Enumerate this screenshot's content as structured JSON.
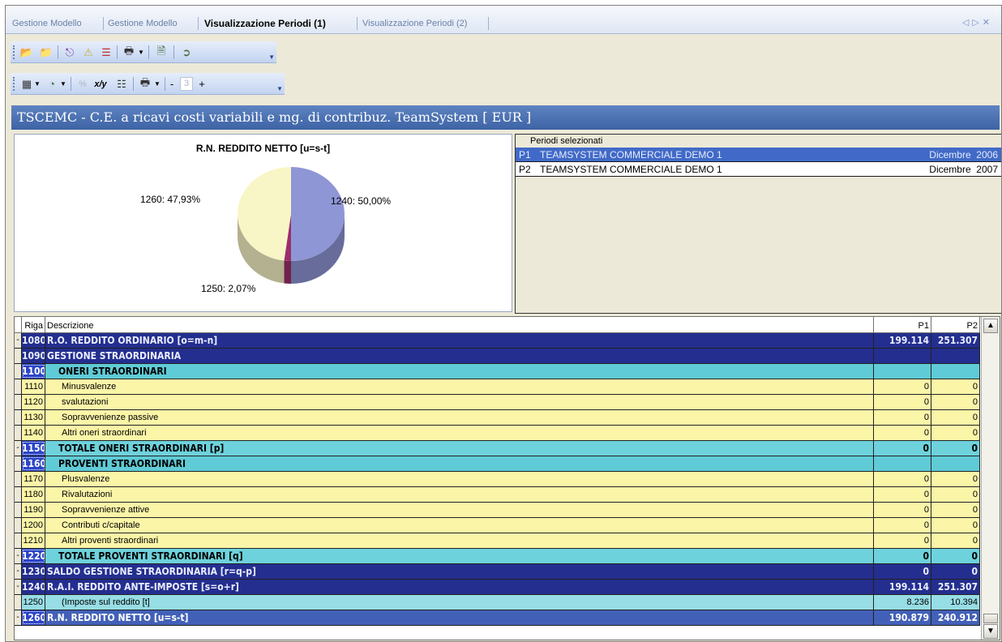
{
  "tabs": [
    {
      "label": "Gestione Modello",
      "active": false
    },
    {
      "label": "Gestione Modello",
      "active": false
    },
    {
      "label": "Visualizzazione Periodi (1)",
      "active": true
    },
    {
      "label": "Visualizzazione Periodi (2)",
      "active": false
    }
  ],
  "tab_nav": {
    "prev": "◁",
    "next": "▷",
    "close": "✕"
  },
  "toolbar2": {
    "field_value": "3",
    "minus": "-",
    "plus": "+",
    "ratio_label": "x/y",
    "percent_label": "%"
  },
  "report_title": "TSCEMC - C.E. a ricavi costi variabili e mg. di contribuz. TeamSystem [ EUR ]",
  "chart": {
    "title": "R.N. REDDITO NETTO [u=s-t]",
    "labels": {
      "a": "1240: 50,00%",
      "b": "1260: 47,93%",
      "c": "1250: 2,07%"
    }
  },
  "chart_data": {
    "type": "pie",
    "title": "R.N. REDDITO NETTO [u=s-t]",
    "slices": [
      {
        "label": "1240",
        "value": 50.0,
        "color": "#8f96d6"
      },
      {
        "label": "1250",
        "value": 2.07,
        "color": "#9b2f6a"
      },
      {
        "label": "1260",
        "value": 47.93,
        "color": "#f8f6c6"
      }
    ]
  },
  "periods": {
    "header": "Periodi selezionati",
    "rows": [
      {
        "code": "P1",
        "name": "TEAMSYSTEM COMMERCIALE DEMO 1",
        "date": "Dicembre  2006",
        "selected": true
      },
      {
        "code": "P2",
        "name": "TEAMSYSTEM COMMERCIALE DEMO 1",
        "date": "Dicembre  2007",
        "selected": false
      }
    ]
  },
  "grid": {
    "headers": {
      "riga": "Riga",
      "descrizione": "Descrizione",
      "p1": "P1",
      "p2": "P2"
    },
    "rows": [
      {
        "mark": "-",
        "riga": "1080",
        "desc": "R.O. REDDITO ORDINARIO [o=m-n]",
        "p1": "199.114",
        "p2": "251.307"
      },
      {
        "mark": "",
        "riga": "1090",
        "desc": "GESTIONE STRAORDINARIA",
        "p1": "",
        "p2": ""
      },
      {
        "mark": "",
        "riga": "1100",
        "desc": "ONERI STRAORDINARI",
        "p1": "",
        "p2": ""
      },
      {
        "mark": "",
        "riga": "1110",
        "desc": "Minusvalenze",
        "p1": "0",
        "p2": "0"
      },
      {
        "mark": "",
        "riga": "1120",
        "desc": "svalutazioni",
        "p1": "0",
        "p2": "0"
      },
      {
        "mark": "",
        "riga": "1130",
        "desc": "Sopravvenienze passive",
        "p1": "0",
        "p2": "0"
      },
      {
        "mark": "",
        "riga": "1140",
        "desc": "Altri oneri straordinari",
        "p1": "0",
        "p2": "0"
      },
      {
        "mark": "-",
        "riga": "1150",
        "desc": "TOTALE ONERI STRAORDINARI [p]",
        "p1": "0",
        "p2": "0"
      },
      {
        "mark": "",
        "riga": "1160",
        "desc": "PROVENTI STRAORDINARI",
        "p1": "",
        "p2": ""
      },
      {
        "mark": "",
        "riga": "1170",
        "desc": "Plusvalenze",
        "p1": "0",
        "p2": "0"
      },
      {
        "mark": "",
        "riga": "1180",
        "desc": "Rivalutazioni",
        "p1": "0",
        "p2": "0"
      },
      {
        "mark": "",
        "riga": "1190",
        "desc": "Sopravvenienze attive",
        "p1": "0",
        "p2": "0"
      },
      {
        "mark": "",
        "riga": "1200",
        "desc": "Contributi c/capitale",
        "p1": "0",
        "p2": "0"
      },
      {
        "mark": "",
        "riga": "1210",
        "desc": "Altri proventi straordinari",
        "p1": "0",
        "p2": "0"
      },
      {
        "mark": "-",
        "riga": "1220",
        "desc": "TOTALE PROVENTI STRAORDINARI [q]",
        "p1": "0",
        "p2": "0"
      },
      {
        "mark": "-",
        "riga": "1230",
        "desc": "SALDO GESTIONE STRAORDINARIA [r=q-p]",
        "p1": "0",
        "p2": "0"
      },
      {
        "mark": "-",
        "riga": "1240",
        "desc": "R.A.I. REDDITO ANTE-IMPOSTE [s=o+r]",
        "p1": "199.114",
        "p2": "251.307"
      },
      {
        "mark": "",
        "riga": "1250",
        "desc": "(Imposte sul reddito [t]",
        "p1": "8.236",
        "p2": "10.394"
      },
      {
        "mark": "-",
        "riga": "1260",
        "desc": "R.N. REDDITO NETTO [u=s-t]",
        "p1": "190.879",
        "p2": "240.912"
      }
    ]
  }
}
